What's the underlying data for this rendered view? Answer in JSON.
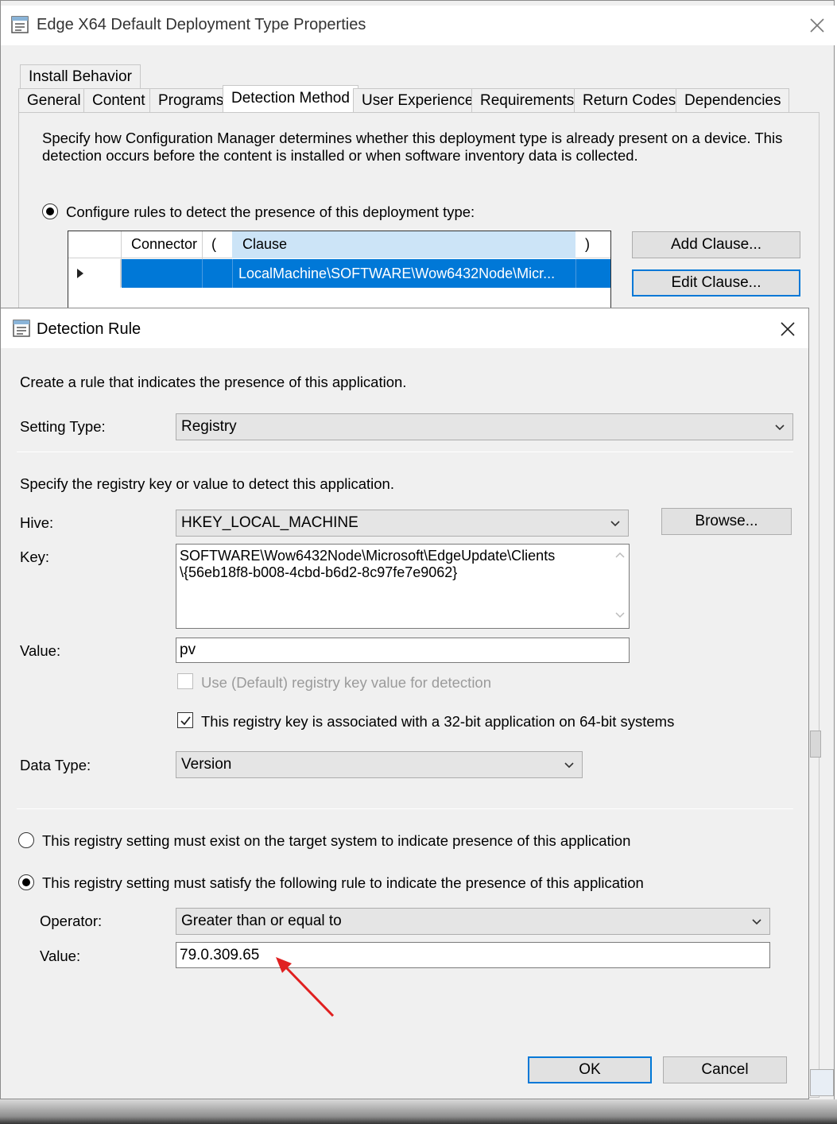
{
  "back_window": {
    "title": "Edge X64 Default Deployment Type Properties",
    "tabs_row1": [
      "Install Behavior"
    ],
    "tabs_row2": [
      "General",
      "Content",
      "Programs",
      "Detection Method",
      "User Experience",
      "Requirements",
      "Return Codes",
      "Dependencies"
    ],
    "active_tab": "Detection Method",
    "description": "Specify how Configuration Manager determines whether this deployment type is already present on a device. This detection occurs before the content is installed or when software inventory data is collected.",
    "description_line1": "Specify how Configuration Manager determines whether this deployment type is already present on a device. This",
    "description_line2": "detection occurs before the content is installed or when software inventory data is collected.",
    "configure_rules_label": "Configure rules to detect the presence of this deployment type:",
    "grid": {
      "columns": [
        "Connector",
        "(",
        "Clause",
        ")"
      ],
      "rows": [
        {
          "connector": "",
          "open": "",
          "clause": "LocalMachine\\SOFTWARE\\Wow6432Node\\Micr...",
          "close": ""
        }
      ]
    },
    "add_clause_label": "Add Clause...",
    "edit_clause_label": "Edit Clause..."
  },
  "dialog": {
    "title": "Detection Rule",
    "intro": "Create a rule that indicates the presence of this application.",
    "setting_type_label": "Setting Type:",
    "setting_type_value": "Registry",
    "registry_intro": "Specify the registry key or value to detect this application.",
    "hive_label": "Hive:",
    "hive_value": "HKEY_LOCAL_MACHINE",
    "browse_label": "Browse...",
    "key_label": "Key:",
    "key_line1": "SOFTWARE\\Wow6432Node\\Microsoft\\EdgeUpdate\\Clients",
    "key_line2": "\\{56eb18f8-b008-4cbd-b6d2-8c97fe7e9062}",
    "value_label": "Value:",
    "value_value": "pv",
    "use_default_label": "Use (Default) registry key value for detection",
    "use_default_checked": false,
    "is32bit_label": "This registry key is associated with a 32-bit application on 64-bit systems",
    "is32bit_checked": true,
    "data_type_label": "Data Type:",
    "data_type_value": "Version",
    "must_exist_label": "This registry setting must exist on the target system to indicate presence of this application",
    "must_satisfy_label": "This registry setting must satisfy the following rule to indicate the presence of this application",
    "selected_option": "must_satisfy",
    "operator_label": "Operator:",
    "operator_value": "Greater than or equal to",
    "rule_value_label": "Value:",
    "rule_value": "79.0.309.65",
    "ok_label": "OK",
    "cancel_label": "Cancel"
  },
  "colors": {
    "accent": "#0078d7",
    "selection": "#0078d7",
    "header_highlight": "#cce4f7",
    "annotation_arrow": "#e02020"
  }
}
